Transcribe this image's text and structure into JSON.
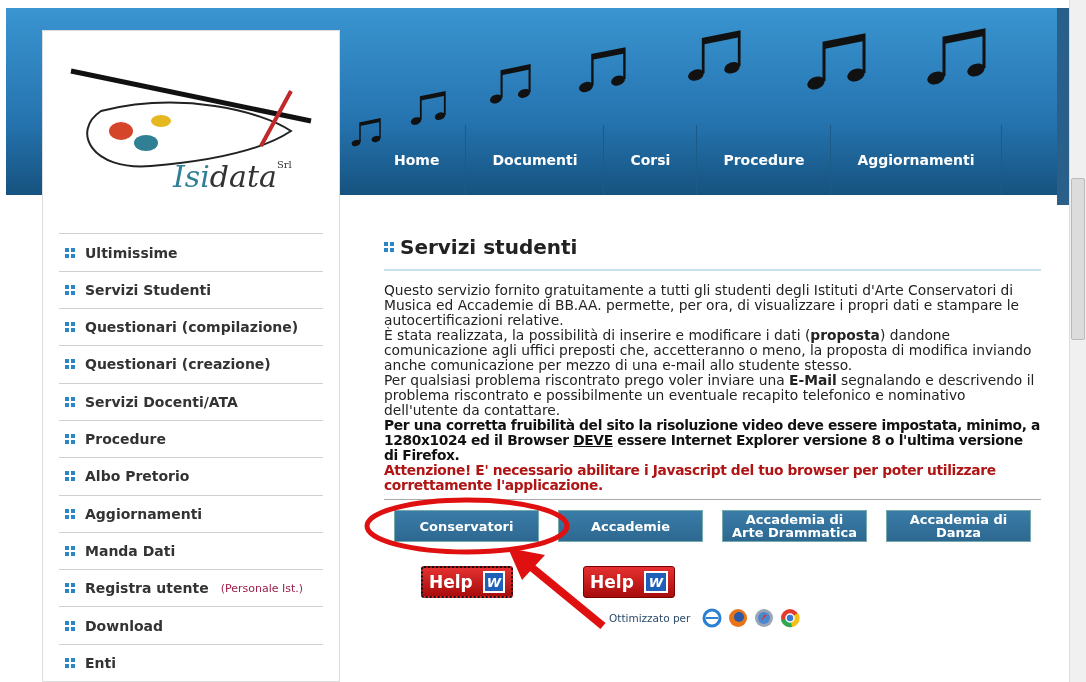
{
  "logo": {
    "wordmark_part1": "Isi",
    "wordmark_part2": "data",
    "suffix": "Srl"
  },
  "nav": [
    {
      "label": "Home"
    },
    {
      "label": "Documenti"
    },
    {
      "label": "Corsi"
    },
    {
      "label": "Procedure"
    },
    {
      "label": "Aggiornamenti"
    }
  ],
  "sidebar": {
    "items": [
      {
        "label": "Ultimissime"
      },
      {
        "label": "Servizi Studenti"
      },
      {
        "label": "Questionari (compilazione)"
      },
      {
        "label": "Questionari (creazione)"
      },
      {
        "label": "Servizi Docenti/ATA"
      },
      {
        "label": "Procedure"
      },
      {
        "label": "Albo Pretorio"
      },
      {
        "label": "Aggiornamenti"
      },
      {
        "label": "Manda Dati"
      },
      {
        "label": "Registra utente",
        "note": "(Personale Ist.)"
      },
      {
        "label": "Download"
      },
      {
        "label": "Enti"
      }
    ]
  },
  "content": {
    "title": "Servizi studenti",
    "paragraphs": [
      "Questo servizio fornito gratuitamente a tutti gli studenti degli Istituti d'Arte Conservatori di Musica ed Accademie di BB.AA. permette, per ora, di visualizzare i propri dati e stampare le autocertificazioni relative.",
      "È stata realizzata, la possibilità di inserire e modificare i dati (**proposta**) dandone comunicazione agli uffici preposti che, accetteranno o meno, la proposta di modifica inviando anche comunicazione per mezzo di una e-mail allo studente stesso.",
      "Per qualsiasi problema riscontrato prego voler inviare una **E-Mail** segnalando e descrivendo il problema riscontrato e possibilmente un eventuale recapito telefonico e nominativo dell'utente da contattare."
    ],
    "requirements": {
      "before": "Per una corretta fruibilità del sito la risoluzione video deve essere impostata, minimo, a 1280x1024 ed il Browser ",
      "link": "DEVE",
      "after": " essere Internet Explorer versione 8 o l'ultima versione di Firefox."
    },
    "warning": "Attenzione! E' necessario abilitare i Javascript del tuo browser per poter utilizzare correttamente l'applicazione.",
    "category_buttons": [
      {
        "lines": [
          "Conservatori"
        ]
      },
      {
        "lines": [
          "Accademie"
        ]
      },
      {
        "lines": [
          "Accademia di",
          "Arte Drammatica"
        ]
      },
      {
        "lines": [
          "Accademia di",
          "Danza"
        ]
      }
    ],
    "help_buttons": [
      {
        "label": "Help",
        "icon_letter": "W",
        "focused": true
      },
      {
        "label": "Help",
        "icon_letter": "W",
        "focused": false
      }
    ],
    "optimized_for": "Ottimizzato per"
  }
}
